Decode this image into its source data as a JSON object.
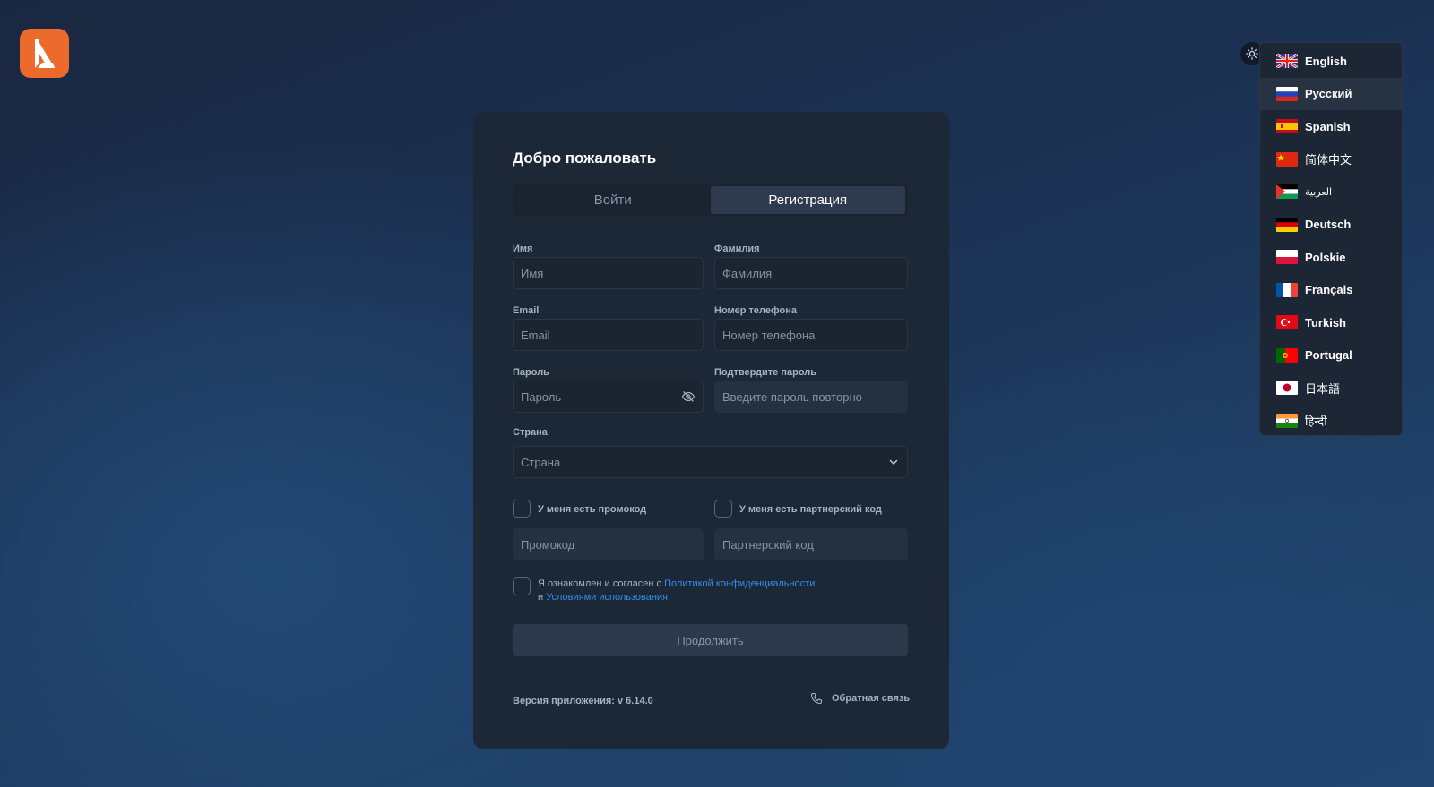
{
  "theme_icon": "sun-icon",
  "logo_icon": "app-logo-icon",
  "languages": [
    {
      "label": "English",
      "flag": "uk"
    },
    {
      "label": "Русский",
      "flag": "ru"
    },
    {
      "label": "Spanish",
      "flag": "es"
    },
    {
      "label": "简体中文",
      "flag": "cn"
    },
    {
      "label": "العربية",
      "flag": "ps"
    },
    {
      "label": "Deutsch",
      "flag": "de"
    },
    {
      "label": "Polskie",
      "flag": "pl"
    },
    {
      "label": "Français",
      "flag": "fr"
    },
    {
      "label": "Turkish",
      "flag": "tr"
    },
    {
      "label": "Portugal",
      "flag": "pt"
    },
    {
      "label": "日本語",
      "flag": "jp"
    },
    {
      "label": "हिन्दी",
      "flag": "in"
    }
  ],
  "form": {
    "title": "Добро пожаловать",
    "tabs": {
      "login": "Войти",
      "register": "Регистрация"
    },
    "first_name": {
      "label": "Имя",
      "placeholder": "Имя"
    },
    "last_name": {
      "label": "Фамилия",
      "placeholder": "Фамилия"
    },
    "email": {
      "label": "Email",
      "placeholder": "Email"
    },
    "phone": {
      "label": "Номер телефона",
      "placeholder": "Номер телефона"
    },
    "password": {
      "label": "Пароль",
      "placeholder": "Пароль"
    },
    "confirm_password": {
      "label": "Подтвердите пароль",
      "placeholder": "Введите пароль повторно"
    },
    "country": {
      "label": "Страна",
      "placeholder": "Страна"
    },
    "promo": {
      "checkbox_label": "У меня есть промокод",
      "placeholder": "Промокод"
    },
    "partner": {
      "checkbox_label": "У меня есть партнерский код",
      "placeholder": "Партнерский код"
    },
    "terms": {
      "prefix": "Я ознакомлен и согласен с",
      "privacy_link": "Политикой конфиденциальности",
      "and": "и",
      "terms_link": "Условиями использования"
    },
    "continue_label": "Продолжить"
  },
  "footer": {
    "version": "Версия приложения: v 6.14.0",
    "feedback": "Обратная связь"
  }
}
